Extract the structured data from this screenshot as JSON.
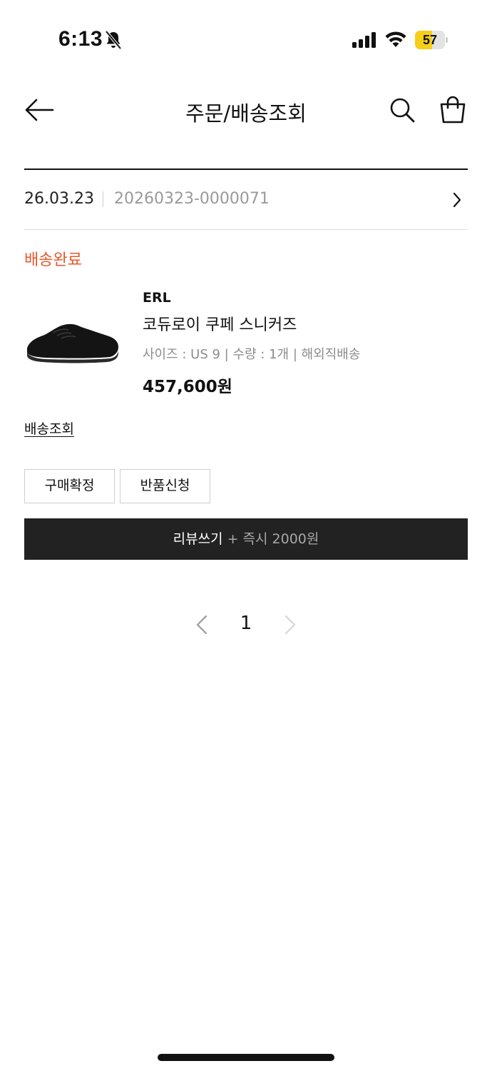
{
  "status_bar": {
    "time": "6:13",
    "battery": "57",
    "battery_level": 0.57,
    "icons": [
      "bell-slash-icon",
      "signal-icon",
      "wifi-icon",
      "battery-icon"
    ]
  },
  "header": {
    "title": "주문/배송조회",
    "icons": [
      "back-arrow-icon",
      "search-icon",
      "shopping-bag-icon"
    ]
  },
  "order": {
    "date": "26.03.23",
    "number": "20260323-0000071",
    "status": "배송완료"
  },
  "product": {
    "brand": "ERL",
    "name": "코듀로이 쿠페 스니커즈",
    "options": "사이즈 : US 9 | 수량 : 1개 | 해외직배송",
    "price": "457,600원"
  },
  "actions": {
    "tracking": "배송조회",
    "confirm": "구매확정",
    "return": "반품신청",
    "review_main": "리뷰쓰기",
    "review_extra": " + 즉시 2000원"
  },
  "pagination": {
    "current": "1"
  },
  "colors": {
    "status_accent": "#e8572c",
    "review_button_bg": "#222222",
    "battery_fill": "#f5cf1a"
  }
}
